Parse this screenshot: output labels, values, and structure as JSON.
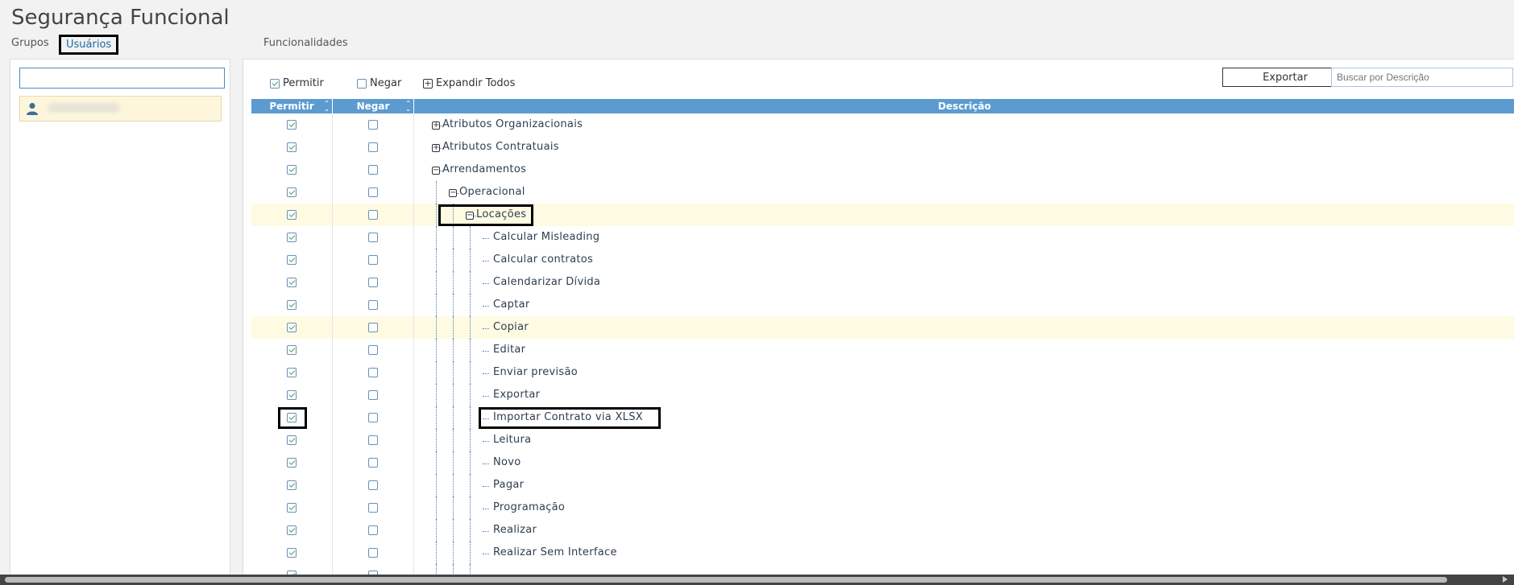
{
  "app": {
    "title": "Segurança Funcional"
  },
  "tabs": {
    "grupos": "Grupos",
    "usuarios": "Usuários",
    "funcionalidades": "Funcionalidades"
  },
  "left": {
    "search_value": "",
    "user_icon": "user-icon"
  },
  "toolbar": {
    "permitir": "Permitir",
    "negar": "Negar",
    "expandir": "Expandir Todos",
    "exportar": "Exportar",
    "search_placeholder": "Buscar por Descrição"
  },
  "grid": {
    "headers": {
      "permitir": "Permitir",
      "negar": "Negar",
      "descricao": "Descrição"
    },
    "rows": [
      {
        "label": "Atributos Organizacionais",
        "level": 0,
        "toggle": "+",
        "permitir": true,
        "negar": false
      },
      {
        "label": "Atributos Contratuais",
        "level": 0,
        "toggle": "+",
        "permitir": true,
        "negar": false
      },
      {
        "label": "Arrendamentos",
        "level": 0,
        "toggle": "−",
        "permitir": true,
        "negar": false
      },
      {
        "label": "Operacional",
        "level": 1,
        "toggle": "−",
        "permitir": true,
        "negar": false
      },
      {
        "label": "Locações",
        "level": 2,
        "toggle": "−",
        "permitir": true,
        "negar": false
      },
      {
        "label": "Calcular Misleading",
        "level": 3,
        "permitir": true,
        "negar": false
      },
      {
        "label": "Calcular contratos",
        "level": 3,
        "permitir": true,
        "negar": false
      },
      {
        "label": "Calendarizar Dívida",
        "level": 3,
        "permitir": true,
        "negar": false
      },
      {
        "label": "Captar",
        "level": 3,
        "permitir": true,
        "negar": false
      },
      {
        "label": "Copiar",
        "level": 3,
        "permitir": true,
        "negar": false
      },
      {
        "label": "Editar",
        "level": 3,
        "permitir": true,
        "negar": false
      },
      {
        "label": "Enviar previsão",
        "level": 3,
        "permitir": true,
        "negar": false
      },
      {
        "label": "Exportar",
        "level": 3,
        "permitir": true,
        "negar": false
      },
      {
        "label": "Importar Contrato via XLSX",
        "level": 3,
        "permitir": true,
        "negar": false
      },
      {
        "label": "Leitura",
        "level": 3,
        "permitir": true,
        "negar": false
      },
      {
        "label": "Novo",
        "level": 3,
        "permitir": true,
        "negar": false
      },
      {
        "label": "Pagar",
        "level": 3,
        "permitir": true,
        "negar": false
      },
      {
        "label": "Programação",
        "level": 3,
        "permitir": true,
        "negar": false
      },
      {
        "label": "Realizar",
        "level": 3,
        "permitir": true,
        "negar": false
      },
      {
        "label": "Realizar Sem Interface",
        "level": 3,
        "permitir": true,
        "negar": false
      },
      {
        "label": "",
        "level": 3,
        "permitir": true,
        "negar": false
      }
    ]
  }
}
